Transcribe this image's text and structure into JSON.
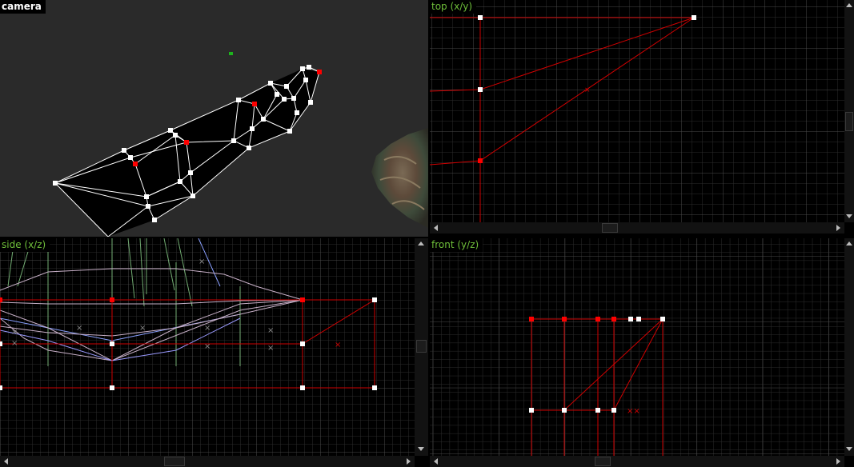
{
  "viewports": {
    "camera": {
      "label": "camera"
    },
    "top": {
      "label": "top (x/y)"
    },
    "side": {
      "label": "side (x/z)"
    },
    "front": {
      "label": "front (y/z)"
    }
  },
  "colors": {
    "camera_bg": "#2a2a2a",
    "ortho_bg": "#000000",
    "grid_minor": "#2c2c2c",
    "grid_major": "#4a4a4a",
    "wire": "#ffffff",
    "selected": "#ff0000",
    "brush_edge": "#d00000",
    "label_text": "#6fbf3a"
  }
}
